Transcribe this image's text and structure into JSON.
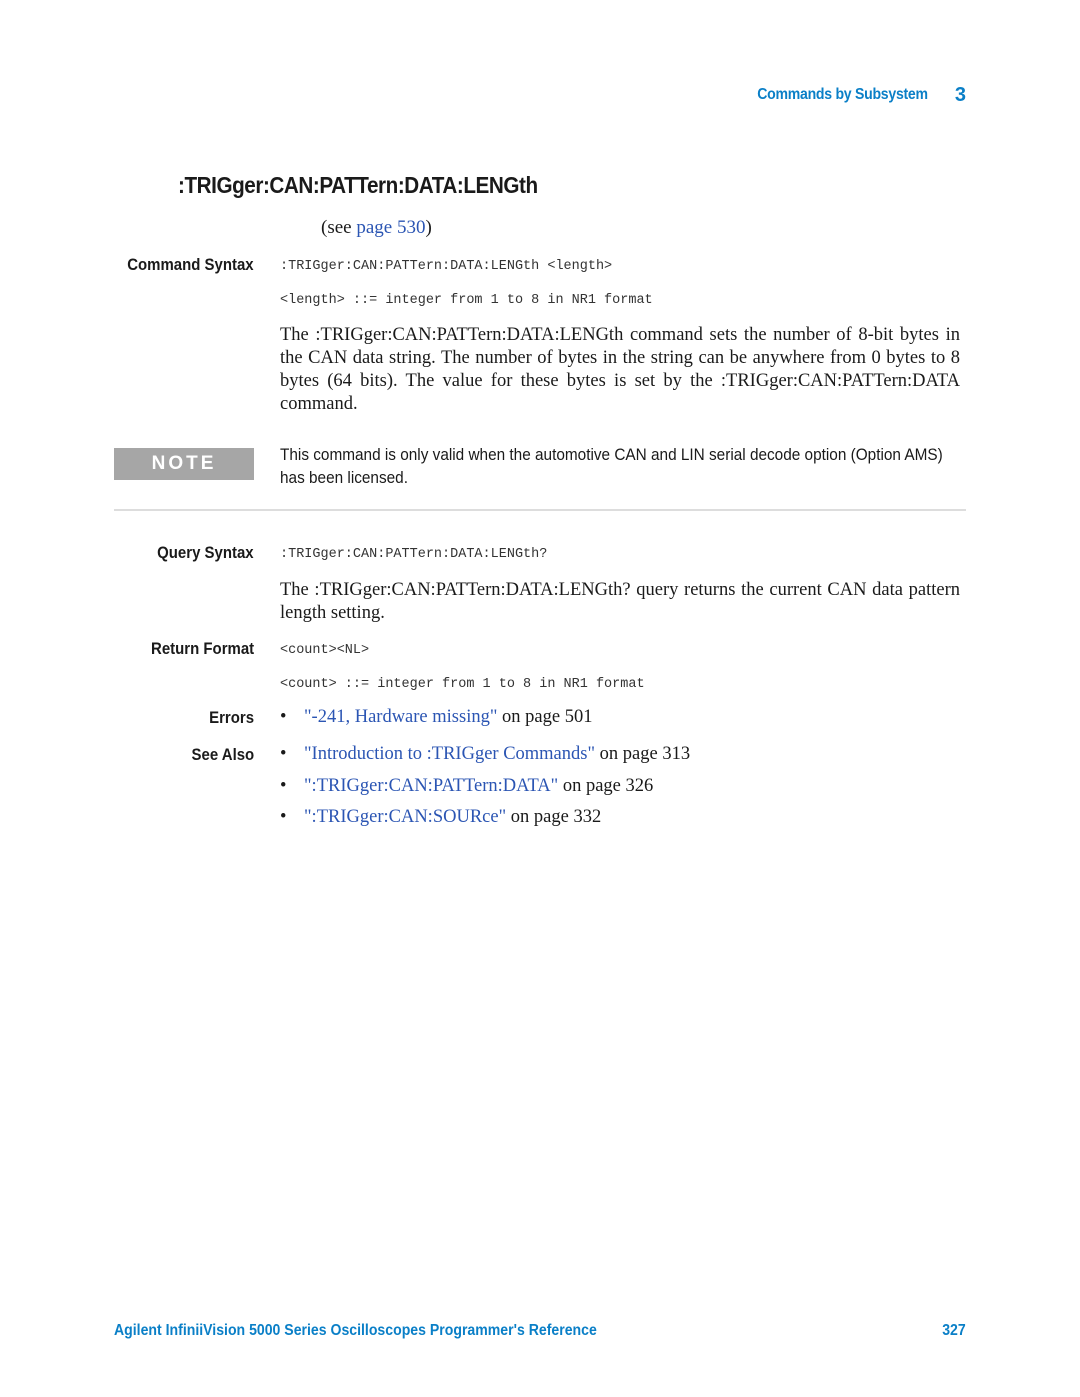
{
  "header": {
    "section": "Commands by Subsystem",
    "chapter": "3"
  },
  "title": ":TRIGger:CAN:PATTern:DATA:LENGth",
  "see_page": {
    "prefix": "(see ",
    "link": "page 530",
    "suffix": ")"
  },
  "command_syntax": {
    "label": "Command Syntax",
    "syntax": ":TRIGger:CAN:PATTern:DATA:LENGth <length>",
    "param": "<length> ::= integer from 1 to 8 in NR1 format",
    "description": "The :TRIGger:CAN:PATTern:DATA:LENGth command sets the number of 8-bit bytes in the CAN data string. The number of bytes in the string can be anywhere from 0 bytes to 8 bytes (64 bits). The value for these bytes is set by the :TRIGger:CAN:PATTern:DATA command."
  },
  "note": {
    "badge": "NOTE",
    "text": "This command is only valid when the automotive CAN and LIN serial decode option (Option AMS) has been licensed."
  },
  "query_syntax": {
    "label": "Query Syntax",
    "syntax": ":TRIGger:CAN:PATTern:DATA:LENGth?",
    "description": "The :TRIGger:CAN:PATTern:DATA:LENGth? query returns the current CAN data pattern length setting."
  },
  "return_format": {
    "label": "Return Format",
    "format": "<count><NL>",
    "param": "<count> ::= integer from 1 to 8 in NR1 format"
  },
  "errors": {
    "label": "Errors",
    "items": [
      {
        "link": "\"-241, Hardware missing\"",
        "suffix": " on page 501"
      }
    ]
  },
  "see_also": {
    "label": "See Also",
    "items": [
      {
        "link": "\"Introduction to :TRIGger Commands\"",
        "suffix": " on page 313"
      },
      {
        "link": "\":TRIGger:CAN:PATTern:DATA\"",
        "suffix": " on page 326"
      },
      {
        "link": "\":TRIGger:CAN:SOURce\"",
        "suffix": " on page 332"
      }
    ]
  },
  "footer": {
    "book_title": "Agilent InfiniiVision 5000 Series Oscilloscopes Programmer's Reference",
    "page_number": "327"
  }
}
